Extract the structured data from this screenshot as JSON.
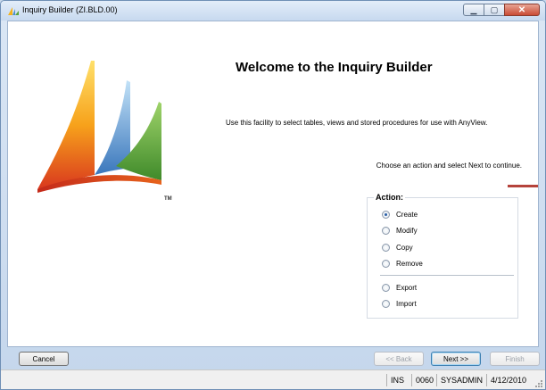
{
  "window": {
    "title": "Inquiry Builder (ZI.BLD.00)",
    "app_icon": "inquiry-builder-icon",
    "minimize_icon": "minimize-icon",
    "maximize_icon": "maximize-icon",
    "close_icon": "close-icon",
    "minimize_glyph": "▁",
    "maximize_glyph": "▢",
    "close_glyph": "✕"
  },
  "main": {
    "logo": "microsoft-dynamics-logo",
    "logo_mark": "TM",
    "heading": "Welcome to the Inquiry Builder",
    "description": "Use this facility to select tables, views and stored procedures for use with AnyView.",
    "instruction": "Choose an action and select Next to continue.",
    "accent_color": "#b5433b"
  },
  "action": {
    "legend": "Action:",
    "selected": "Create",
    "options": [
      {
        "label": "Create",
        "selected": true
      },
      {
        "label": "Modify",
        "selected": false
      },
      {
        "label": "Copy",
        "selected": false
      },
      {
        "label": "Remove",
        "selected": false
      },
      {
        "label": "Export",
        "selected": false
      },
      {
        "label": "Import",
        "selected": false
      }
    ]
  },
  "buttons": {
    "cancel": "Cancel",
    "back": "<< Back",
    "next": "Next >>",
    "finish": "Finish"
  },
  "statusbar": {
    "mode": "INS",
    "company": "0060",
    "user": "SYSADMIN",
    "date": "4/12/2010"
  }
}
